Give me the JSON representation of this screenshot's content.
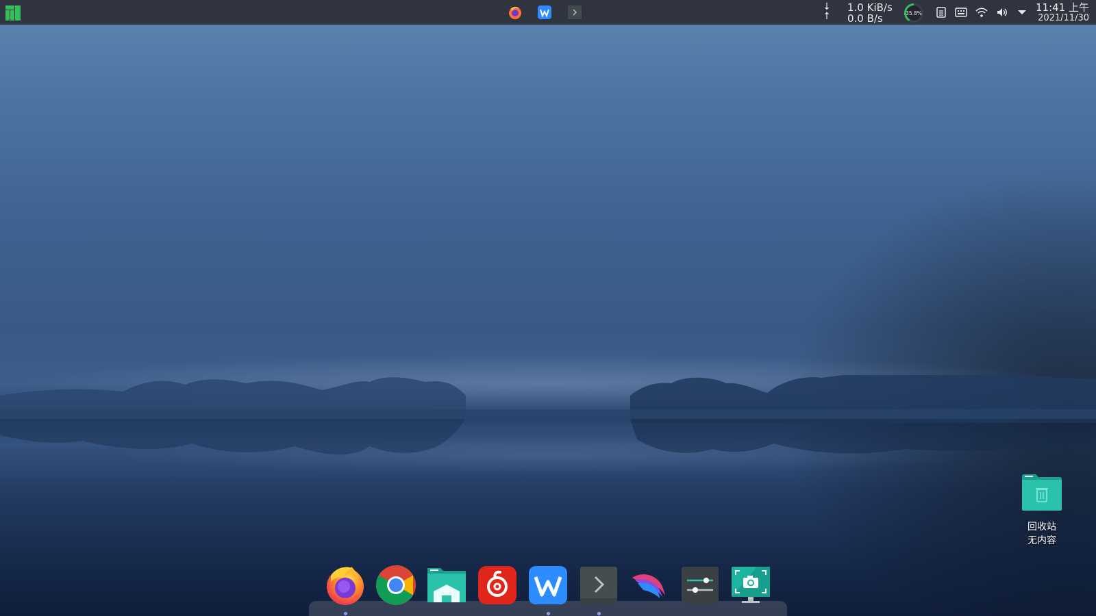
{
  "top_panel": {
    "logo_icon": "manjaro-logo-icon",
    "taskbar": [
      {
        "name": "firefox",
        "icon": "firefox-icon"
      },
      {
        "name": "wps-writer",
        "icon": "wps-icon"
      },
      {
        "name": "terminal",
        "icon": "terminal-icon"
      }
    ],
    "network": {
      "download_arrow": "↓",
      "upload_arrow": "↑",
      "download_speed": "1.0 KiB/s",
      "upload_speed": "0.0 B/s"
    },
    "cpu_usage": "35.8%",
    "tray_icons": [
      "clipboard-icon",
      "keyboard-icon",
      "wifi-icon",
      "volume-icon",
      "tray-expand-icon"
    ],
    "clock": {
      "time": "11:41 上午",
      "date": "2021/11/30"
    },
    "colors": {
      "panel_bg": "#2f343f",
      "accent": "#35bf5c"
    }
  },
  "desktop": {
    "trash": {
      "icon": "trash-folder-icon",
      "label": "回收站",
      "sublabel": "无内容"
    }
  },
  "dock": {
    "items": [
      {
        "name": "firefox",
        "icon": "firefox-icon",
        "running": true
      },
      {
        "name": "chrome",
        "icon": "chrome-icon",
        "running": false
      },
      {
        "name": "file-manager",
        "icon": "file-manager-icon",
        "running": false
      },
      {
        "name": "netease-music",
        "icon": "netease-music-icon",
        "running": false
      },
      {
        "name": "wps",
        "icon": "wps-icon",
        "running": true
      },
      {
        "name": "terminal",
        "icon": "terminal-icon",
        "running": true
      },
      {
        "name": "kali-app",
        "icon": "kali-dragon-icon",
        "running": false
      },
      {
        "name": "settings",
        "icon": "settings-sliders-icon",
        "running": false
      },
      {
        "name": "screenshot",
        "icon": "screenshot-icon",
        "running": false
      }
    ],
    "colors": {
      "running_indicator": "#8a9cff"
    }
  }
}
